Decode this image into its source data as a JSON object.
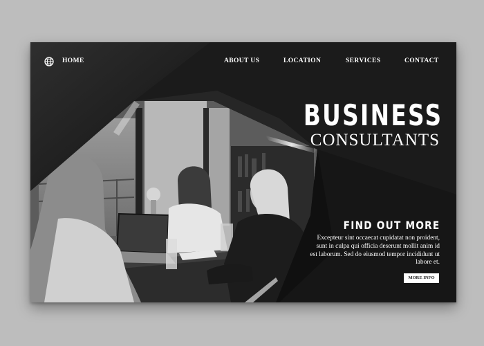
{
  "nav": {
    "home": "HOME",
    "about": "ABOUT US",
    "location": "LOCATION",
    "services": "SERVICES",
    "contact": "CONTACT"
  },
  "hero": {
    "title": "BUSINESS",
    "subtitle": "CONSULTANTS"
  },
  "promo": {
    "heading": "FIND OUT MORE",
    "body": "Excepteur sint occaecat cupidatat non proident, sunt in culpa qui officia deserunt mollit anim id est laborum. Sed do eiusmod tempor incididunt ut labore et.",
    "button": "MORE INFO"
  },
  "icons": {
    "nav_logo": "globe-icon"
  },
  "colors": {
    "background": "#bdbdbd",
    "panel": "#1a1a1a",
    "text": "#ffffff",
    "button_bg": "#ffffff"
  }
}
